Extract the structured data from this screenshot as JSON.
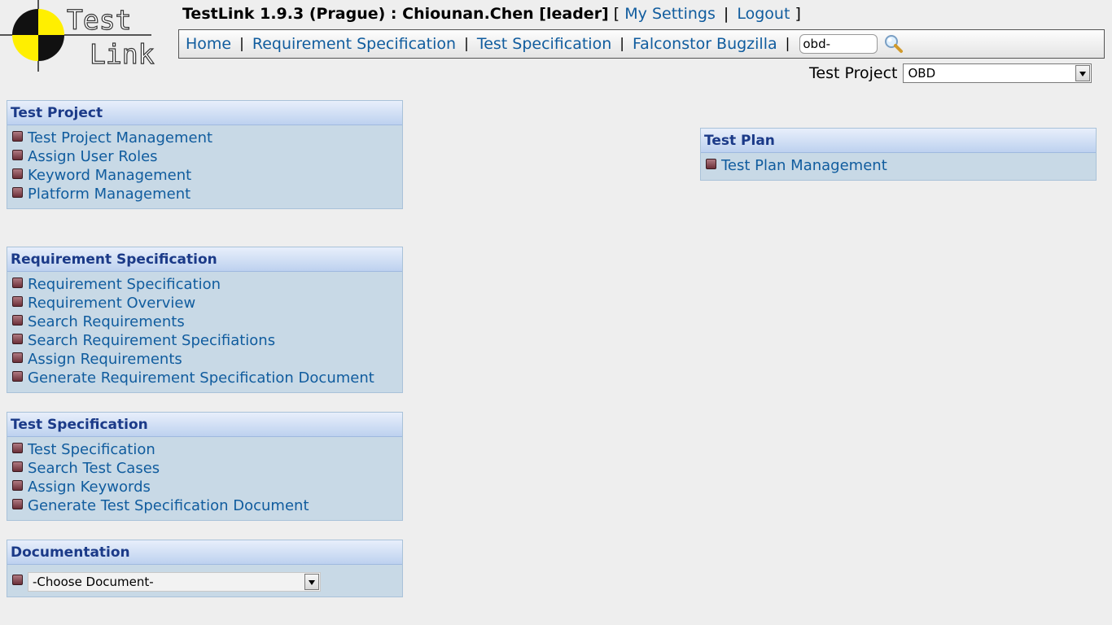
{
  "header": {
    "app_title": "TestLink 1.9.3 (Prague) : Chiounan.Chen [leader]",
    "open_bracket": "[",
    "close_bracket": "]",
    "separator": "|",
    "my_settings": "My Settings",
    "logout": "Logout"
  },
  "logo": {
    "line1": "Test",
    "line2": "Link"
  },
  "nav": {
    "items": [
      "Home",
      "Requirement Specification",
      "Test Specification",
      "Falconstor Bugzilla"
    ],
    "separator": "|",
    "search_value": "obd-"
  },
  "project_selector": {
    "label": "Test Project",
    "selected": "OBD"
  },
  "panels": {
    "test_project": {
      "title": "Test Project",
      "items": [
        "Test Project Management",
        "Assign User Roles",
        "Keyword Management",
        "Platform Management"
      ]
    },
    "requirement_spec": {
      "title": "Requirement Specification",
      "items": [
        "Requirement Specification",
        "Requirement Overview",
        "Search Requirements",
        "Search Requirement Specifiations",
        "Assign Requirements",
        "Generate Requirement Specification Document"
      ]
    },
    "test_spec": {
      "title": "Test Specification",
      "items": [
        "Test Specification",
        "Search Test Cases",
        "Assign Keywords",
        "Generate Test Specification Document"
      ]
    },
    "documentation": {
      "title": "Documentation",
      "select_value": "-Choose Document-"
    },
    "test_plan": {
      "title": "Test Plan",
      "items": [
        "Test Plan Management"
      ]
    }
  },
  "colors": {
    "link": "#105c9e",
    "panel_bg": "#c8d9e6",
    "panel_title": "#1b3a88",
    "bullet": "#8a4a54"
  },
  "icons": [
    "testlink-logo",
    "search-icon",
    "bullet-icon",
    "dropdown-arrow-icon"
  ]
}
